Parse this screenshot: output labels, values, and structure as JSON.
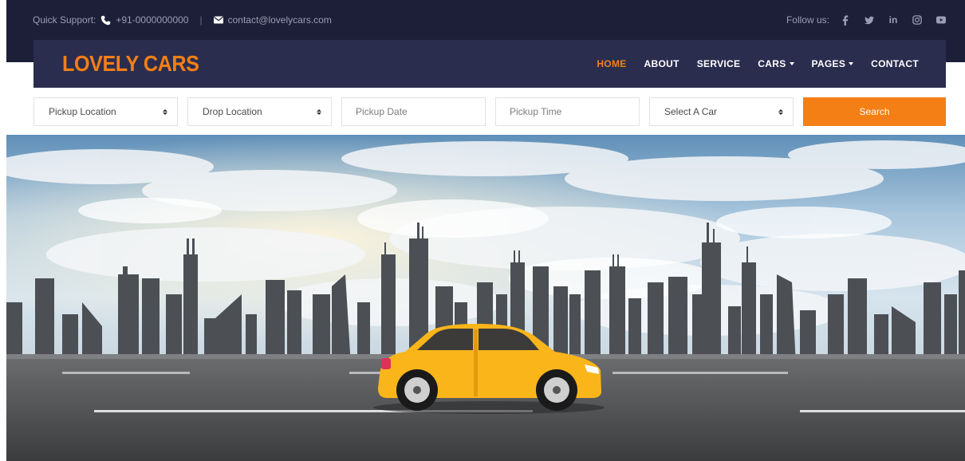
{
  "topbar": {
    "support_label": "Quick Support:",
    "phone": "+91-0000000000",
    "separator": "|",
    "email": "contact@lovelycars.com",
    "follow_label": "Follow us:",
    "socials": [
      "facebook-icon",
      "twitter-icon",
      "linkedin-icon",
      "instagram-icon",
      "youtube-icon"
    ]
  },
  "navbar": {
    "logo": "LOVELY CARS",
    "items": [
      {
        "label": "HOME",
        "active": true
      },
      {
        "label": "ABOUT"
      },
      {
        "label": "SERVICE"
      },
      {
        "label": "CARS",
        "dropdown": true
      },
      {
        "label": "PAGES",
        "dropdown": true
      },
      {
        "label": "CONTACT"
      }
    ]
  },
  "search": {
    "pickup_location": "Pickup Location",
    "drop_location": "Drop Location",
    "pickup_date_placeholder": "Pickup Date",
    "pickup_time_placeholder": "Pickup Time",
    "select_car": "Select A Car",
    "button": "Search"
  },
  "colors": {
    "accent": "#f47f15",
    "topbar_bg": "#1c1f37",
    "navbar_bg": "#2b2d4f",
    "car_body": "#f9b51a"
  }
}
